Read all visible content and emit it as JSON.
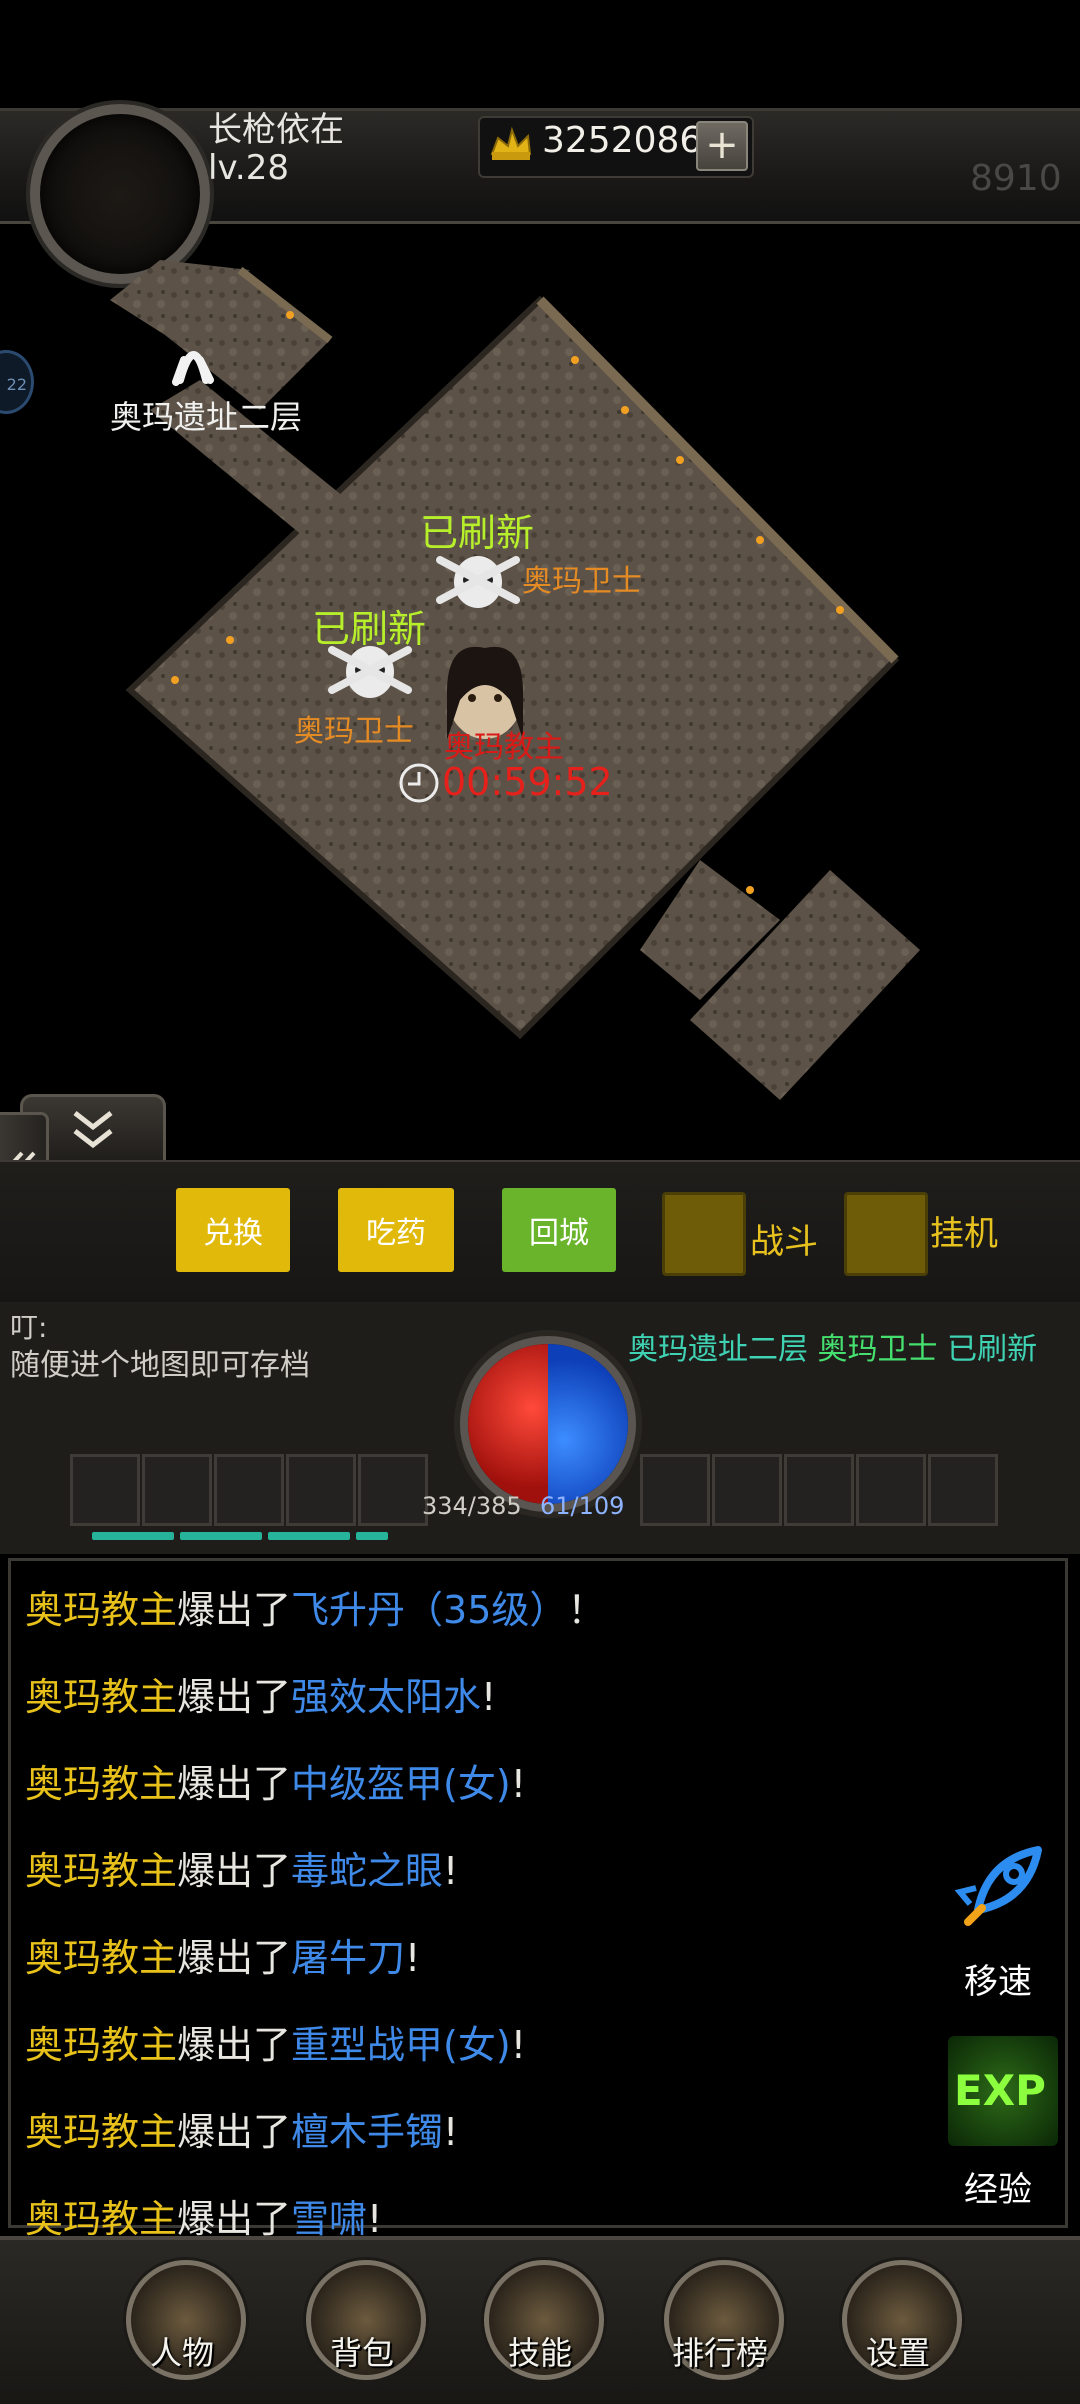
{
  "player": {
    "name": "长枪依在",
    "level": "lv.28"
  },
  "currency": {
    "gold": "3252086",
    "plus_label": "+"
  },
  "power": "8910",
  "side_bubble": "22",
  "map": {
    "portal_name": "奥玛遗址二层",
    "monsters": [
      {
        "status": "已刷新",
        "name": "奥玛卫士"
      },
      {
        "status": "已刷新",
        "name": "奥玛卫士"
      }
    ],
    "boss": {
      "name": "奥玛教主",
      "timer": "00:59:52"
    }
  },
  "controls": {
    "exchange": "兑换",
    "potion": "吃药",
    "return_city": "回城",
    "fight": "战斗",
    "auto": "挂机"
  },
  "system": {
    "prefix": "叮:",
    "message": "随便进个地图即可存档",
    "notice": {
      "map": "奥玛遗址二层",
      "monster": "奥玛卫士",
      "status": "已刷新"
    }
  },
  "stats": {
    "hp": "334/385",
    "mp": "61/109"
  },
  "chat": [
    {
      "boss": "奥玛教主",
      "mid": "爆出了",
      "item": "飞升丹（35级）",
      "end": "！"
    },
    {
      "boss": "奥玛教主",
      "mid": "爆出了",
      "item": "强效太阳水",
      "end": "!"
    },
    {
      "boss": "奥玛教主",
      "mid": "爆出了",
      "item": "中级盔甲(女)",
      "end": "!"
    },
    {
      "boss": "奥玛教主",
      "mid": "爆出了",
      "item": "毒蛇之眼",
      "end": "!"
    },
    {
      "boss": "奥玛教主",
      "mid": "爆出了",
      "item": "屠牛刀",
      "end": "!"
    },
    {
      "boss": "奥玛教主",
      "mid": "爆出了",
      "item": "重型战甲(女)",
      "end": "!"
    },
    {
      "boss": "奥玛教主",
      "mid": "爆出了",
      "item": "檀木手镯",
      "end": "!"
    },
    {
      "boss": "奥玛教主",
      "mid": "爆出了",
      "item": "雪啸",
      "end": "!"
    }
  ],
  "side_actions": {
    "speed": "移速",
    "exp_badge": "EXP",
    "exp": "经验"
  },
  "nav": [
    "人物",
    "背包",
    "技能",
    "排行榜",
    "设置"
  ],
  "colors": {
    "refresh": "#b7ef2b",
    "guard": "#e58b24",
    "boss": "#d91a16",
    "item": "#3f8ae8",
    "gold_text": "#e8c21a"
  }
}
